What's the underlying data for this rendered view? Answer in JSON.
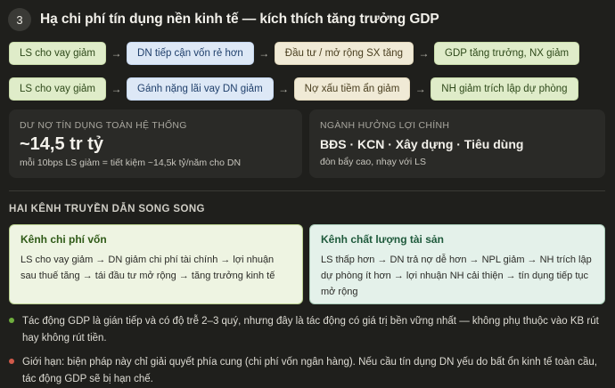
{
  "header": {
    "step_number": "3",
    "title": "Hạ chi phí tín dụng nền kinh tế — kích thích tăng trưởng GDP"
  },
  "flow_rows": [
    {
      "items": [
        {
          "label": "LS cho vay giảm",
          "color": "green"
        },
        {
          "label": "DN tiếp cận vốn rẻ hơn",
          "color": "blue"
        },
        {
          "label": "Đầu tư / mở rộng SX tăng",
          "color": "beige"
        },
        {
          "label": "GDP tăng trưởng, NX giảm",
          "color": "green"
        }
      ]
    },
    {
      "items": [
        {
          "label": "LS cho vay giảm",
          "color": "green"
        },
        {
          "label": "Gánh nặng lãi vay DN giảm",
          "color": "blue"
        },
        {
          "label": "Nợ xấu tiềm ẩn giảm",
          "color": "beige"
        },
        {
          "label": "NH giảm trích lập dự phòng",
          "color": "green"
        }
      ]
    }
  ],
  "cards": {
    "left": {
      "label": "DƯ NỢ TÍN DỤNG TOÀN HỆ THỐNG",
      "value": "~14,5 tr tỷ",
      "sub": "mỗi 10bps LS giảm = tiết kiệm ~14,5k tỷ/năm cho DN"
    },
    "right": {
      "label": "NGÀNH HƯỞNG LỢI CHÍNH",
      "value": "BĐS · KCN · Xây dựng · Tiêu dùng",
      "sub": "đòn bẩy cao, nhạy với LS"
    }
  },
  "section": {
    "heading": "HAI KÊNH TRUYỀN DẪN SONG SONG"
  },
  "channels": {
    "left": {
      "title": "Kênh chi phí vốn",
      "body": "LS cho vay giảm → DN giảm chi phí tài chính → lợi nhuận sau thuế tăng → tái đầu tư mở rộng → tăng trưởng kinh tế"
    },
    "right": {
      "title": "Kênh chất lượng tài sản",
      "body": "LS thấp hơn → DN trả nợ dễ hơn → NPL giảm → NH trích lập dự phòng ít hơn → lợi nhuận NH cải thiện → tín dụng tiếp tục mở rộng"
    }
  },
  "notes": [
    {
      "color": "green",
      "text": "Tác động GDP là gián tiếp và có độ trễ 2–3 quý, nhưng đây là tác động có giá trị bền vững nhất — không phụ thuộc vào KB rút hay không rút tiền."
    },
    {
      "color": "red",
      "text": "Giới hạn: biện pháp này chỉ giải quyết phía cung (chi phí vốn ngân hàng). Nếu cầu tín dụng DN yếu do bất ổn kinh tế toàn cầu, tác động GDP sẽ bị hạn chế."
    }
  ],
  "icons": {
    "flow_arrow": "arrow-right-icon"
  }
}
